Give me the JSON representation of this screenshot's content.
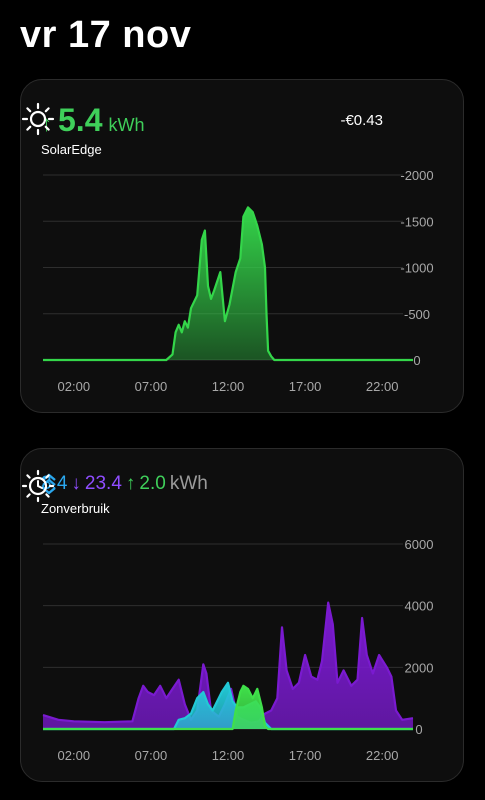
{
  "header": {
    "date": "vr 17 nov"
  },
  "solar_card": {
    "arrow": "↑",
    "value": "5.4",
    "unit": "kWh",
    "name": "SolarEdge",
    "cost": "-€0.43",
    "icon": "sun-icon",
    "colors": {
      "accent": "#3fcf5a"
    }
  },
  "usage_card": {
    "swap_icon": "updown-chevron-icon",
    "self_use": "3.4",
    "down_arrow": "↓",
    "import": "23.4",
    "up_arrow": "↑",
    "export": "2.0",
    "unit": "kWh",
    "name": "Zonverbruik",
    "icon": "sun-clock-icon",
    "colors": {
      "self_use": "#2aa7ee",
      "import": "#8f4dff",
      "export": "#3fcf5a"
    }
  },
  "chart_data": [
    {
      "type": "area",
      "x_ticks": [
        "02:00",
        "07:00",
        "12:00",
        "17:00",
        "22:00"
      ],
      "y_ticks": [
        "-2000",
        "-1500",
        "-1000",
        "-500",
        "0"
      ],
      "ylim": [
        0,
        2000
      ],
      "xlim_hours": [
        0,
        24
      ],
      "grid": true,
      "series": [
        {
          "color": "#34d64a",
          "points": [
            [
              0,
              0
            ],
            [
              8,
              0
            ],
            [
              8.4,
              60
            ],
            [
              8.6,
              300
            ],
            [
              8.8,
              380
            ],
            [
              9.0,
              300
            ],
            [
              9.2,
              420
            ],
            [
              9.4,
              350
            ],
            [
              9.6,
              560
            ],
            [
              10.0,
              700
            ],
            [
              10.3,
              1300
            ],
            [
              10.5,
              1400
            ],
            [
              10.7,
              800
            ],
            [
              10.9,
              660
            ],
            [
              11.1,
              750
            ],
            [
              11.5,
              950
            ],
            [
              11.8,
              420
            ],
            [
              12.1,
              600
            ],
            [
              12.5,
              950
            ],
            [
              12.8,
              1100
            ],
            [
              13.0,
              1550
            ],
            [
              13.3,
              1650
            ],
            [
              13.6,
              1600
            ],
            [
              13.9,
              1450
            ],
            [
              14.2,
              1250
            ],
            [
              14.4,
              1000
            ],
            [
              14.5,
              500
            ],
            [
              14.6,
              100
            ],
            [
              14.8,
              40
            ],
            [
              15.0,
              0
            ],
            [
              24,
              0
            ]
          ]
        }
      ]
    },
    {
      "type": "area",
      "x_ticks": [
        "02:00",
        "07:00",
        "12:00",
        "17:00",
        "22:00"
      ],
      "y_ticks": [
        "6000",
        "4000",
        "2000",
        "0"
      ],
      "ylim": [
        0,
        6000
      ],
      "xlim_hours": [
        0,
        24
      ],
      "grid": true,
      "series": [
        {
          "color": "#7a1ad0",
          "points": [
            [
              0,
              450
            ],
            [
              1,
              300
            ],
            [
              2,
              250
            ],
            [
              4,
              220
            ],
            [
              5.8,
              250
            ],
            [
              6.2,
              1000
            ],
            [
              6.5,
              1400
            ],
            [
              6.8,
              1200
            ],
            [
              7.2,
              1100
            ],
            [
              7.6,
              1400
            ],
            [
              8.0,
              1000
            ],
            [
              8.4,
              1300
            ],
            [
              8.8,
              1600
            ],
            [
              9.2,
              800
            ],
            [
              9.6,
              300
            ],
            [
              10,
              600
            ],
            [
              10.4,
              2100
            ],
            [
              10.6,
              1800
            ],
            [
              10.9,
              600
            ],
            [
              11.4,
              400
            ],
            [
              11.8,
              800
            ],
            [
              12.2,
              1300
            ],
            [
              12.6,
              400
            ],
            [
              13.0,
              300
            ],
            [
              13.5,
              200
            ],
            [
              14.0,
              250
            ],
            [
              14.4,
              500
            ],
            [
              14.8,
              600
            ],
            [
              15.2,
              1000
            ],
            [
              15.5,
              3300
            ],
            [
              15.8,
              1900
            ],
            [
              16.2,
              1300
            ],
            [
              16.6,
              1500
            ],
            [
              17.0,
              2400
            ],
            [
              17.4,
              1700
            ],
            [
              17.8,
              1600
            ],
            [
              18.1,
              2200
            ],
            [
              18.5,
              4100
            ],
            [
              18.8,
              3400
            ],
            [
              19.1,
              1500
            ],
            [
              19.5,
              1900
            ],
            [
              20.0,
              1400
            ],
            [
              20.4,
              1600
            ],
            [
              20.7,
              3600
            ],
            [
              21.0,
              2400
            ],
            [
              21.4,
              1800
            ],
            [
              21.8,
              2400
            ],
            [
              22.3,
              2000
            ],
            [
              22.6,
              1700
            ],
            [
              22.9,
              600
            ],
            [
              23.3,
              300
            ],
            [
              24,
              350
            ]
          ]
        },
        {
          "color": "#22c8d6",
          "points": [
            [
              0,
              0
            ],
            [
              8.5,
              0
            ],
            [
              8.8,
              300
            ],
            [
              9.2,
              350
            ],
            [
              9.6,
              500
            ],
            [
              10.0,
              1000
            ],
            [
              10.4,
              1200
            ],
            [
              10.7,
              800
            ],
            [
              11.0,
              600
            ],
            [
              11.3,
              900
            ],
            [
              11.6,
              1200
            ],
            [
              12.0,
              1500
            ],
            [
              12.3,
              900
            ],
            [
              12.6,
              700
            ],
            [
              13.0,
              700
            ],
            [
              13.4,
              800
            ],
            [
              13.8,
              900
            ],
            [
              14.1,
              700
            ],
            [
              14.4,
              200
            ],
            [
              14.8,
              0
            ],
            [
              24,
              0
            ]
          ]
        },
        {
          "color": "#3fe04a",
          "points": [
            [
              0,
              0
            ],
            [
              12.3,
              0
            ],
            [
              12.5,
              600
            ],
            [
              12.8,
              1200
            ],
            [
              13.0,
              1400
            ],
            [
              13.3,
              1300
            ],
            [
              13.6,
              1000
            ],
            [
              13.9,
              1300
            ],
            [
              14.2,
              700
            ],
            [
              14.4,
              100
            ],
            [
              14.6,
              0
            ],
            [
              24,
              0
            ]
          ]
        }
      ]
    }
  ]
}
